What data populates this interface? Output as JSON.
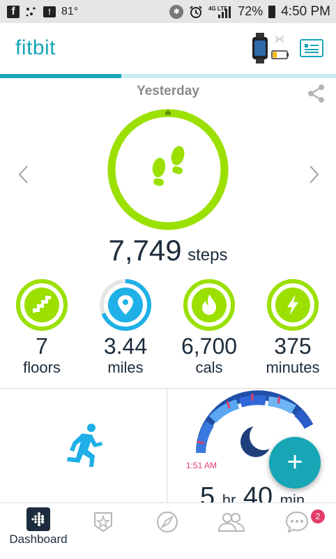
{
  "status_bar": {
    "temperature": "81°",
    "network": "4G LTE",
    "battery_pct": "72%",
    "time": "4:50 PM",
    "icons": [
      "facebook-icon",
      "dots-icon",
      "message-icon",
      "bluetooth-icon",
      "alarm-icon",
      "signal-icon",
      "battery-icon"
    ]
  },
  "header": {
    "logo": "fitbit",
    "tracker_icon": "watch-icon",
    "battery_level": 0.3,
    "sync_icon": "wireless-icon",
    "card_icon": "profile-card-icon",
    "page_progress": 0.36
  },
  "day": {
    "label": "Yesterday",
    "share_icon": "share-icon"
  },
  "main_stat": {
    "value": "7,749",
    "unit": "steps",
    "icon": "footsteps-icon",
    "progress": 1.0
  },
  "stats": [
    {
      "value": "7",
      "unit": "floors",
      "icon": "stairs-icon",
      "progress": 1.0
    },
    {
      "value": "3.44",
      "unit": "miles",
      "icon": "location-pin-icon",
      "progress": 0.69
    },
    {
      "value": "6,700",
      "unit": "cals",
      "icon": "flame-icon",
      "progress": 1.0
    },
    {
      "value": "375",
      "unit": "minutes",
      "icon": "lightning-icon",
      "progress": 1.0
    }
  ],
  "tiles": {
    "exercise_icon": "running-person-icon",
    "sleep": {
      "start_time": "1:51 AM",
      "hours": "5",
      "hours_unit": "hr",
      "minutes": "40",
      "minutes_unit": "min",
      "icon": "moon-icon"
    }
  },
  "fab": {
    "label": "+"
  },
  "bottom_nav": [
    {
      "label": "Dashboard",
      "icon": "fitbit-dots-icon",
      "active": true
    },
    {
      "label": "",
      "icon": "challenges-star-icon"
    },
    {
      "label": "",
      "icon": "compass-icon"
    },
    {
      "label": "",
      "icon": "friends-icon"
    },
    {
      "label": "",
      "icon": "chat-icon",
      "badge": "2"
    }
  ],
  "colors": {
    "brand": "#16a6b6",
    "goal_green": "#9be000",
    "text_dark": "#1c2c3c",
    "accent_blue": "#1eb0e6",
    "badge_pink": "#e23b6a"
  }
}
